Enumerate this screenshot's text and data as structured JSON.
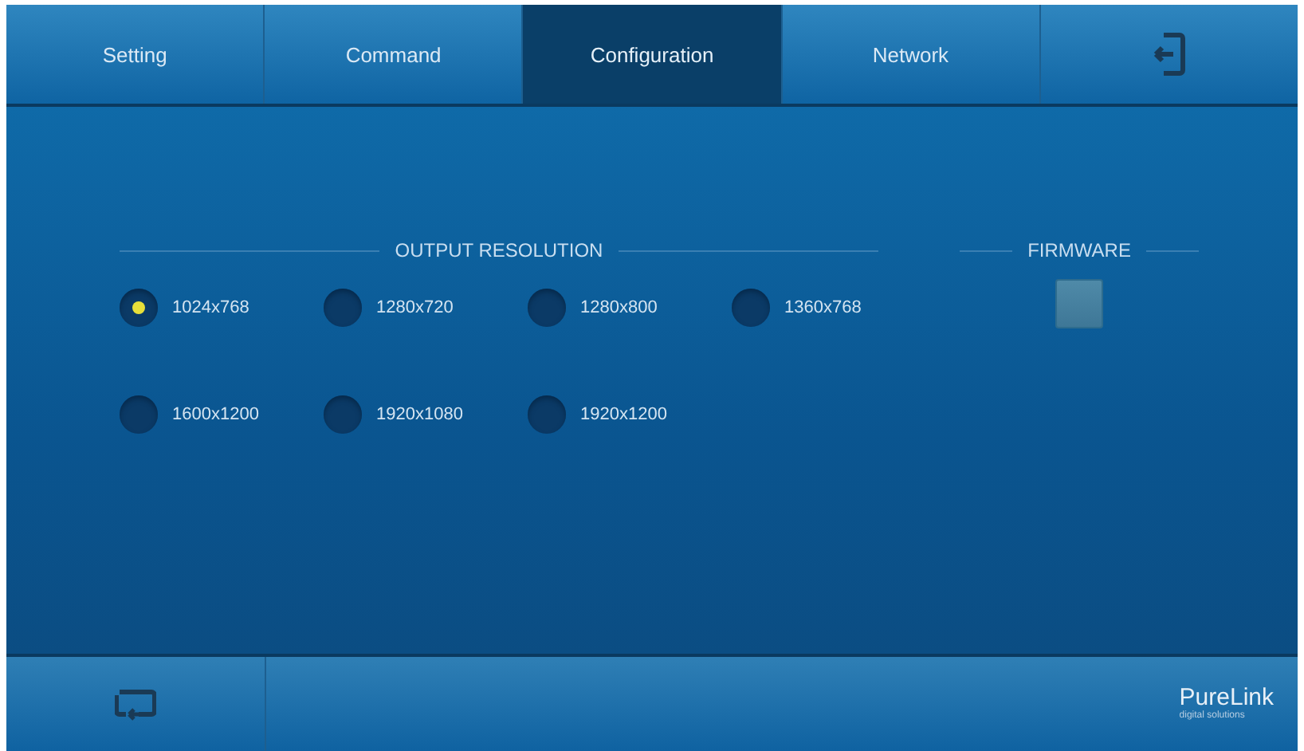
{
  "tabs": [
    {
      "kind": "text",
      "label": "Setting",
      "selected": false
    },
    {
      "kind": "text",
      "label": "Command",
      "selected": false
    },
    {
      "kind": "text",
      "label": "Configuration",
      "selected": true
    },
    {
      "kind": "text",
      "label": "Network",
      "selected": false
    },
    {
      "kind": "exit",
      "selected": false
    }
  ],
  "output_resolution": {
    "title": "OUTPUT RESOLUTION",
    "options": [
      {
        "label": "1024x768",
        "selected": true
      },
      {
        "label": "1280x720",
        "selected": false
      },
      {
        "label": "1280x800",
        "selected": false
      },
      {
        "label": "1360x768",
        "selected": false
      },
      {
        "label": "1600x1200",
        "selected": false
      },
      {
        "label": "1920x1080",
        "selected": false
      },
      {
        "label": "1920x1200",
        "selected": false
      }
    ]
  },
  "firmware": {
    "title": "FIRMWARE"
  },
  "bottom_bar": {
    "logo": {
      "name": "PureLink",
      "tagline": "digital solutions"
    }
  }
}
